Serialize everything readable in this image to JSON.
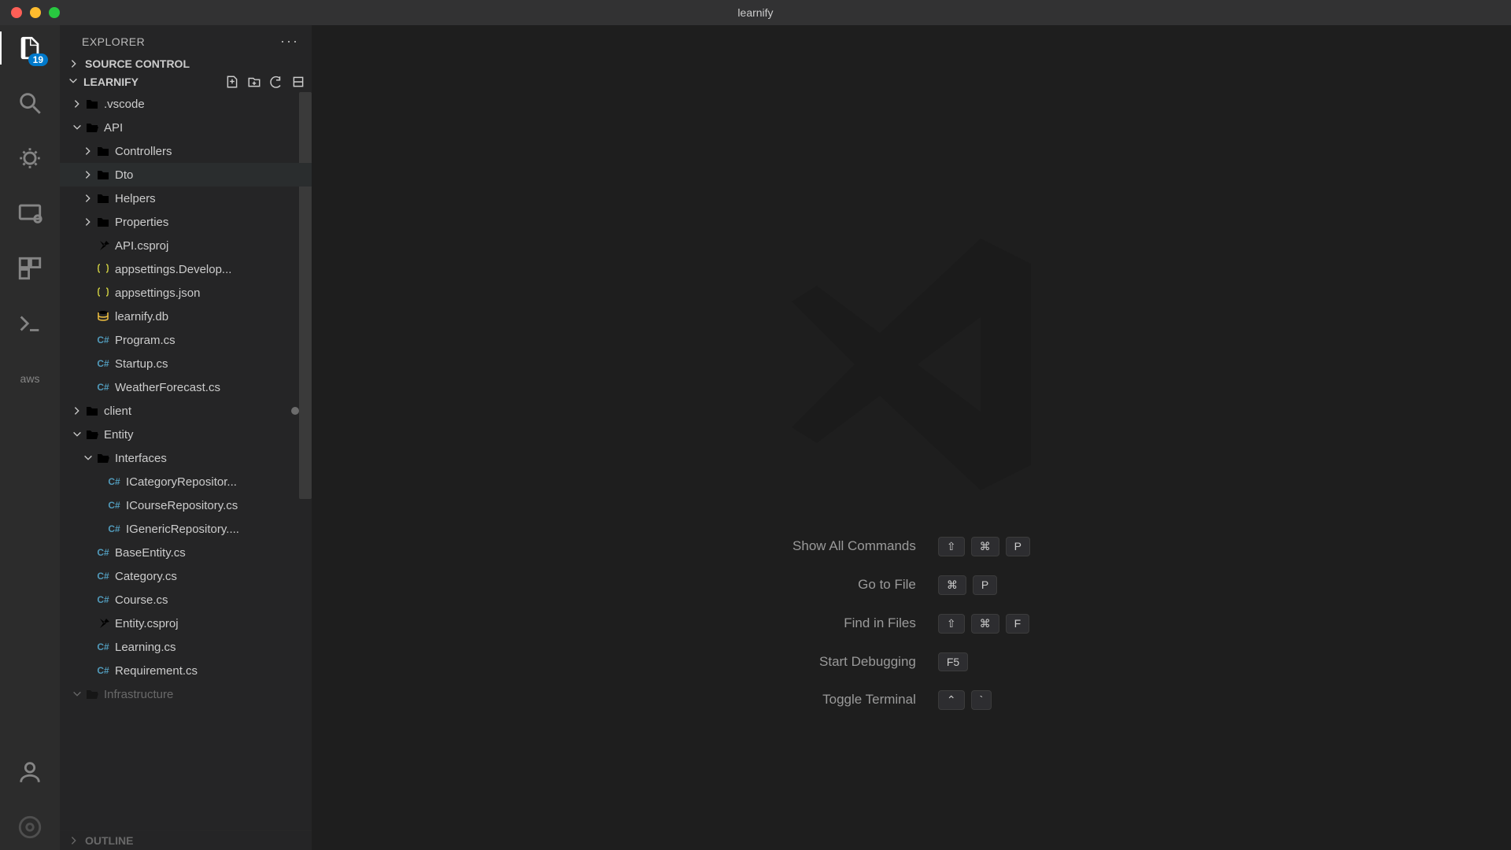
{
  "titlebar": {
    "title": "learnify"
  },
  "activitybar": {
    "explorer_badge": "19",
    "aws_label": "aws"
  },
  "sidebar": {
    "title": "EXPLORER",
    "more": "···",
    "sections": {
      "source_control": "SOURCE CONTROL",
      "project": "LEARNIFY",
      "outline": "OUTLINE"
    }
  },
  "tree": {
    "vscode": ".vscode",
    "api": "API",
    "controllers": "Controllers",
    "dto": "Dto",
    "helpers": "Helpers",
    "properties": "Properties",
    "api_csproj": "API.csproj",
    "appsettings_dev": "appsettings.Develop...",
    "appsettings": "appsettings.json",
    "learnify_db": "learnify.db",
    "program": "Program.cs",
    "startup": "Startup.cs",
    "weather": "WeatherForecast.cs",
    "client": "client",
    "entity": "Entity",
    "interfaces": "Interfaces",
    "icategory": "ICategoryRepositor...",
    "icourse": "ICourseRepository.cs",
    "igeneric": "IGenericRepository....",
    "baseentity": "BaseEntity.cs",
    "category": "Category.cs",
    "course": "Course.cs",
    "entity_csproj": "Entity.csproj",
    "learning": "Learning.cs",
    "requirement": "Requirement.cs",
    "infrastructure": "Infrastructure"
  },
  "commands": {
    "show_all": {
      "label": "Show All Commands",
      "keys": [
        "⇧",
        "⌘",
        "P"
      ]
    },
    "goto_file": {
      "label": "Go to File",
      "keys": [
        "⌘",
        "P"
      ]
    },
    "find_files": {
      "label": "Find in Files",
      "keys": [
        "⇧",
        "⌘",
        "F"
      ]
    },
    "start_debug": {
      "label": "Start Debugging",
      "keys": [
        "F5"
      ]
    },
    "toggle_term": {
      "label": "Toggle Terminal",
      "keys": [
        "⌃",
        "`"
      ]
    }
  }
}
